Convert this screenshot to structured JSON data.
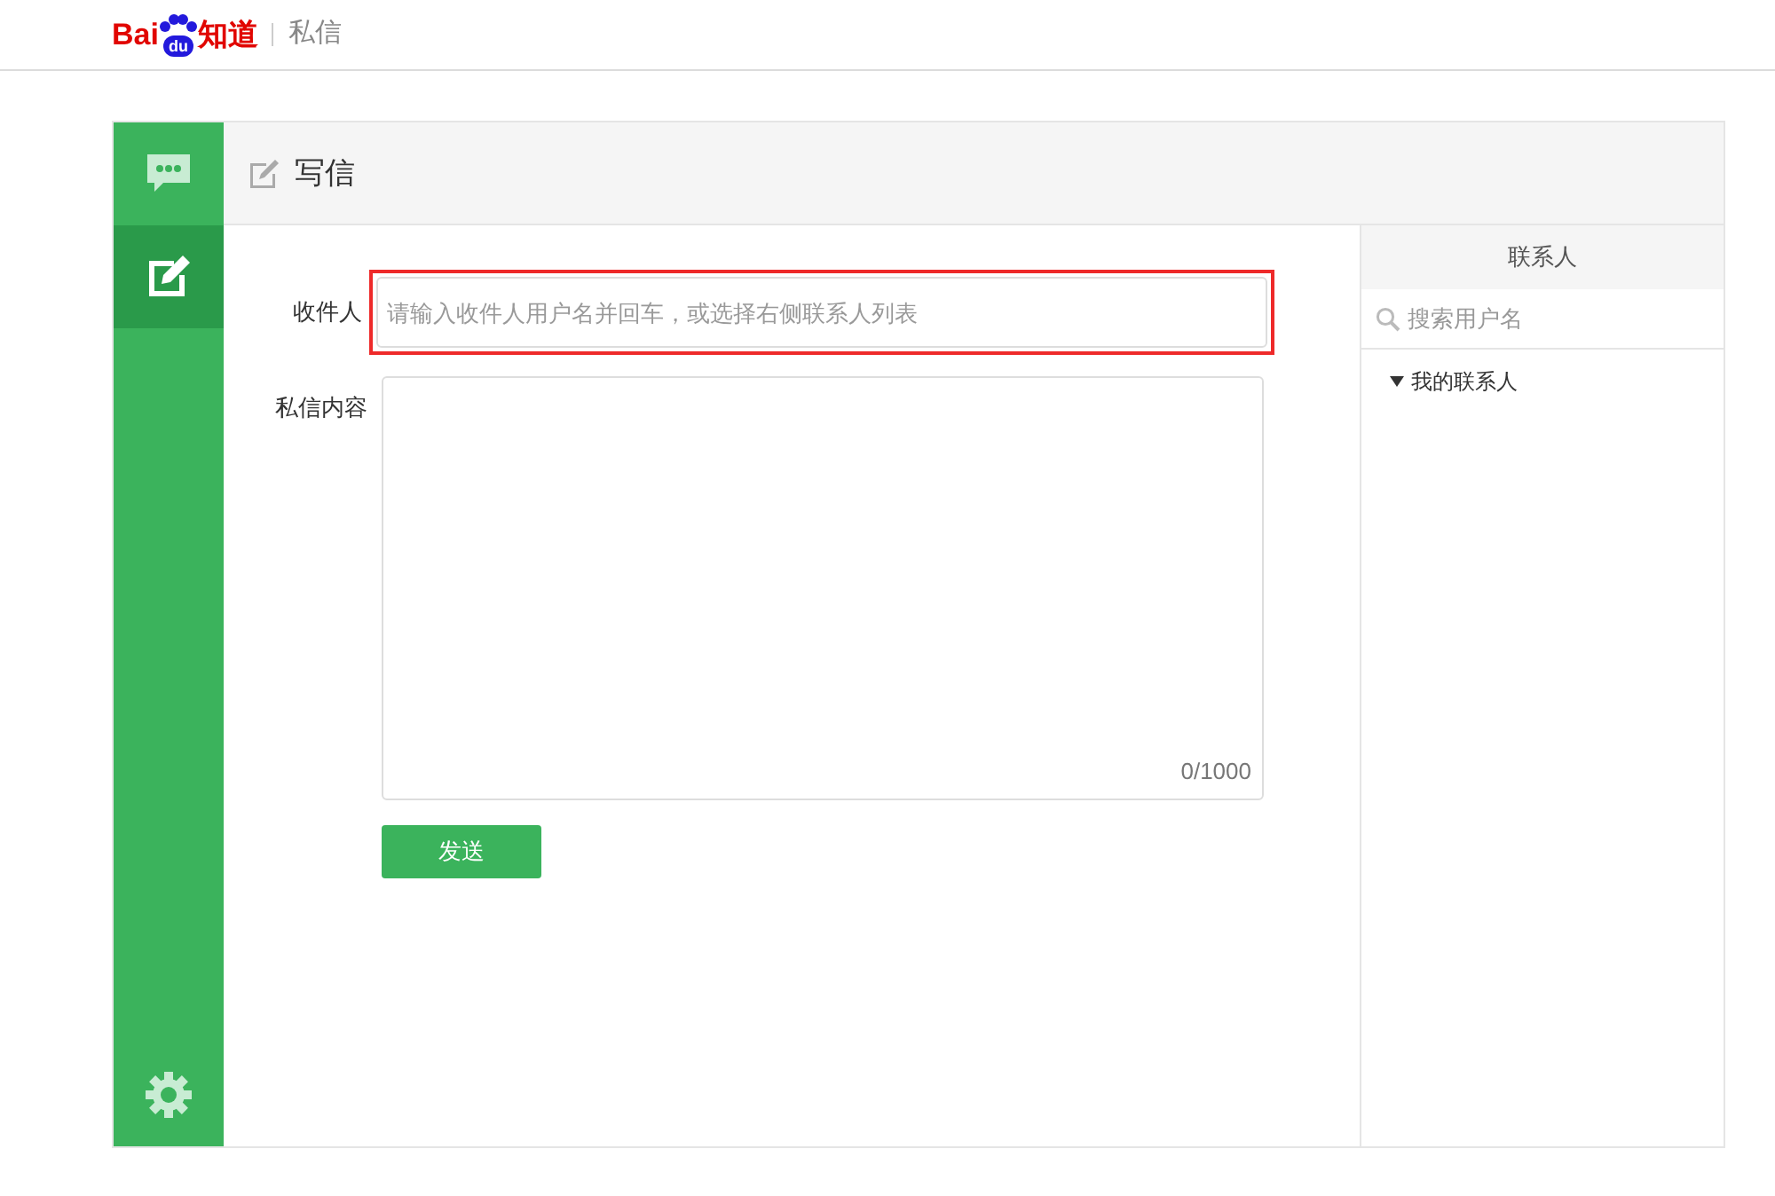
{
  "header": {
    "logo": {
      "left": "Bai",
      "paw": "du",
      "right": "知道"
    },
    "section": "私信"
  },
  "sidebar": {
    "items": [
      {
        "kind": "messages",
        "selected": false
      },
      {
        "kind": "compose",
        "selected": true
      }
    ]
  },
  "compose": {
    "title": "写信",
    "recipient": {
      "label": "收件人",
      "placeholder": "请输入收件人用户名并回车，或选择右侧联系人列表"
    },
    "content": {
      "label": "私信内容",
      "counter": "0/1000"
    },
    "send": "发送"
  },
  "contacts": {
    "title": "联系人",
    "search": {
      "placeholder": "搜索用户名"
    },
    "groups": [
      {
        "label": "我的联系人",
        "expanded": true
      }
    ]
  }
}
